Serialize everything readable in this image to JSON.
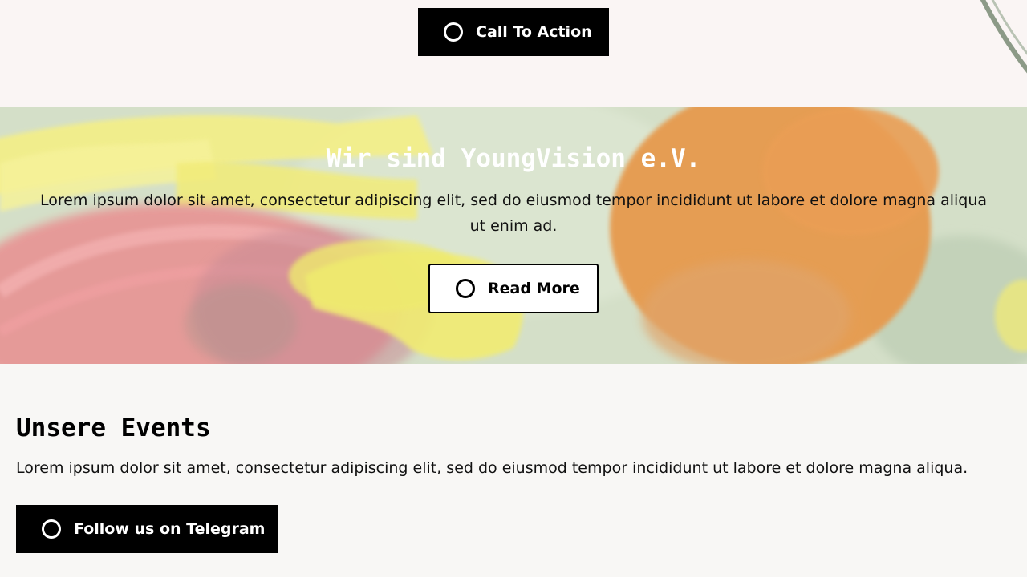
{
  "top": {
    "cta_label": "Call To Action"
  },
  "hero": {
    "title": "Wir sind YoungVision e.V.",
    "text": "Lorem ipsum dolor sit amet, consectetur adipiscing elit, sed do eiusmod tempor incididunt ut labore et dolore magna aliqua ut enim ad.",
    "button_label": "Read More"
  },
  "events": {
    "title": "Unsere Events",
    "text": "Lorem ipsum dolor sit amet, consectetur adipiscing elit, sed do eiusmod tempor incididunt ut labore et dolore magna aliqua.",
    "button_label": "Follow us on Telegram"
  },
  "colors": {
    "top_background": "#faf5f4",
    "page_background": "#f8f7f5",
    "button_dark": "#000000",
    "hero_green": "#d6e1cb",
    "hero_orange": "#e8974a",
    "hero_yellow": "#f3ee7e",
    "hero_pink": "#e88a8c"
  },
  "icons": {
    "button_icon": "circle-outline-icon"
  }
}
